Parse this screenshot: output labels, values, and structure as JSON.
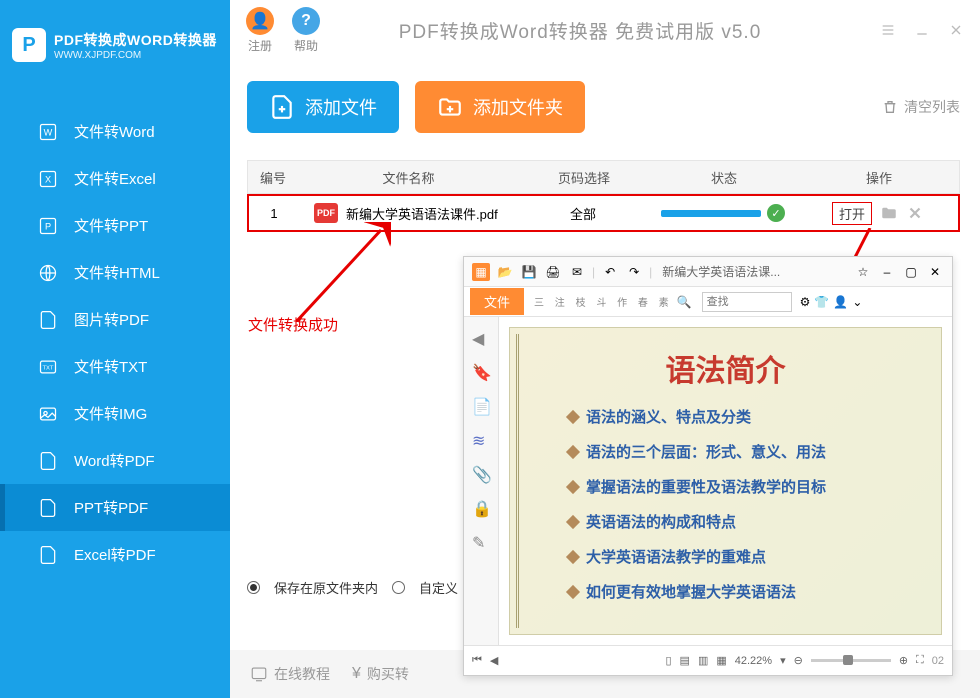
{
  "logo": {
    "badge": "P",
    "title": "PDF转换成WORD转换器",
    "url": "WWW.XJPDF.COM"
  },
  "topbar": {
    "register": "注册",
    "help": "帮助",
    "appTitle": "PDF转换成Word转换器 免费试用版 v5.0"
  },
  "nav": [
    {
      "label": "文件转Word"
    },
    {
      "label": "文件转Excel"
    },
    {
      "label": "文件转PPT"
    },
    {
      "label": "文件转HTML"
    },
    {
      "label": "图片转PDF"
    },
    {
      "label": "文件转TXT"
    },
    {
      "label": "文件转IMG"
    },
    {
      "label": "Word转PDF"
    },
    {
      "label": "PPT转PDF"
    },
    {
      "label": "Excel转PDF"
    }
  ],
  "toolbar": {
    "addFile": "添加文件",
    "addFolder": "添加文件夹",
    "clear": "清空列表"
  },
  "thead": {
    "col1": "编号",
    "col2": "文件名称",
    "col3": "页码选择",
    "col4": "状态",
    "col5": "操作"
  },
  "row": {
    "num": "1",
    "name": "新编大学英语语法课件.pdf",
    "pages": "全部",
    "open": "打开"
  },
  "annotation": "文件转换成功",
  "options": {
    "opt1": "保存在原文件夹内",
    "opt2": "自定义"
  },
  "footer": {
    "tutorial": "在线教程",
    "buy": "购买转"
  },
  "preview": {
    "docTitle": "新编大学英语语法课...",
    "tab": "文件",
    "search": "查找",
    "zoom": "42.22%",
    "page": "02",
    "h1": "语法简介",
    "lines": [
      "语法的涵义、特点及分类",
      "语法的三个层面：形式、意义、用法",
      "掌握语法的重要性及语法教学的目标",
      "英语语法的构成和特点",
      "大学英语语法教学的重难点",
      "如何更有效地掌握大学英语语法"
    ]
  }
}
